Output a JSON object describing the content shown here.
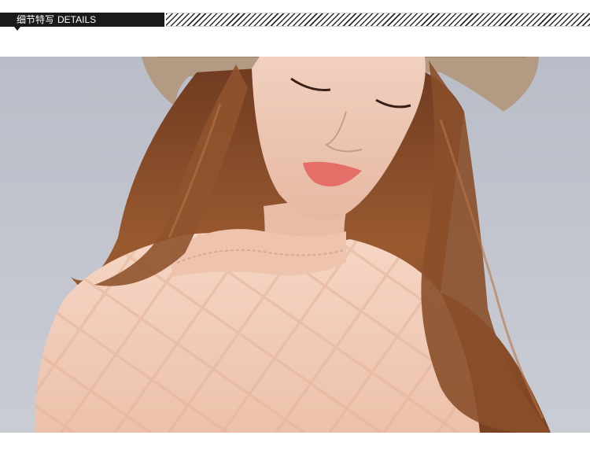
{
  "header": {
    "title_cn": "细节特写",
    "title_en": "DETAILS"
  },
  "colors": {
    "tab_background": "#1a1a1a",
    "tab_text": "#ffffff",
    "photo_background": "#c3c6cf",
    "blouse": "#f2cbb7",
    "hair": "#8a4f2c"
  },
  "photo": {
    "subject": "model-wearing-hat-and-lace-blouse"
  }
}
